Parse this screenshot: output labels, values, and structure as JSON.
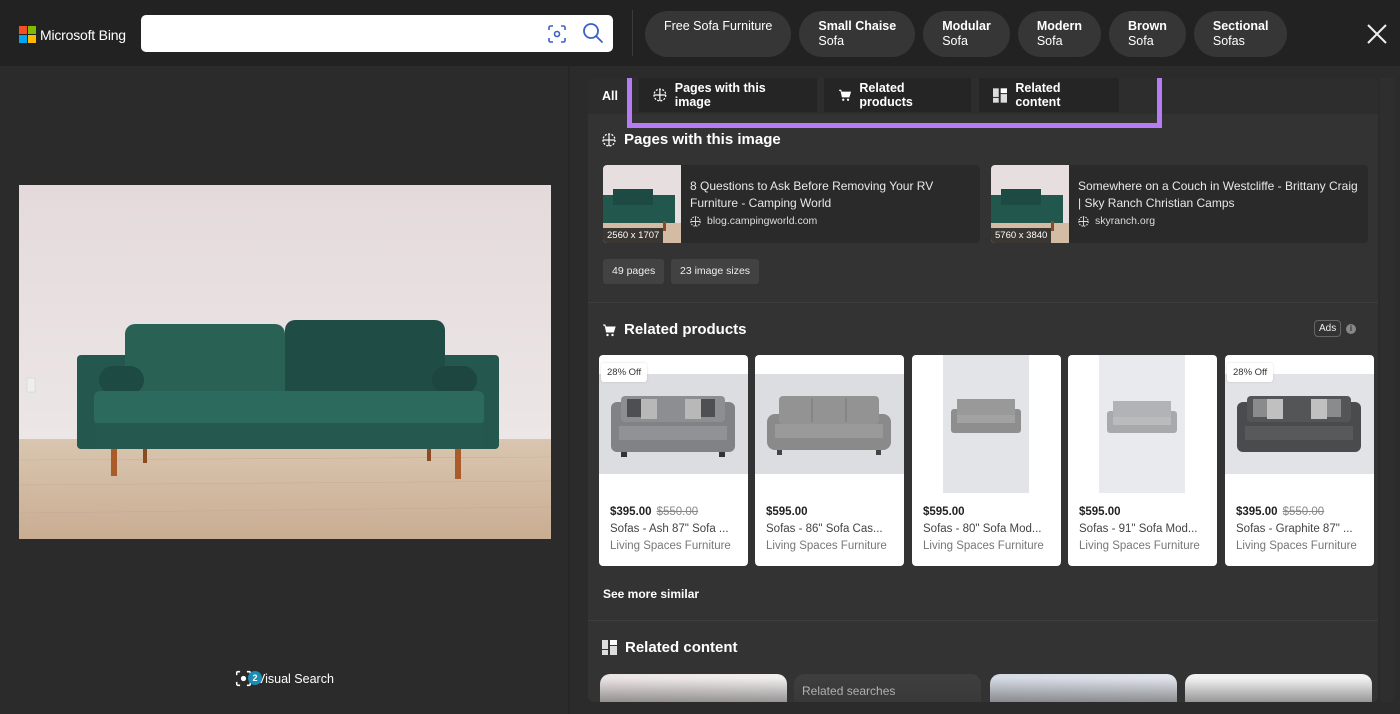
{
  "header": {
    "brand": "Microsoft Bing",
    "search": {
      "value": "",
      "placeholder": ""
    },
    "chips": [
      {
        "line1": "Free Sofa Furniture",
        "line2": ""
      },
      {
        "line1": "Small Chaise",
        "line2": "Sofa"
      },
      {
        "line1": "Modular",
        "line2": "Sofa"
      },
      {
        "line1": "Modern",
        "line2": "Sofa"
      },
      {
        "line1": "Brown",
        "line2": "Sofa"
      },
      {
        "line1": "Sectional",
        "line2": "Sofas"
      }
    ],
    "close_icon": "close-icon"
  },
  "left": {
    "visual_search_label": "Visual Search",
    "visual_search_badge": "2"
  },
  "tabs": {
    "all": "All",
    "items": [
      {
        "label": "Pages with this image",
        "icon": "globe-icon"
      },
      {
        "label": "Related products",
        "icon": "cart-icon"
      },
      {
        "label": "Related content",
        "icon": "grid-icon"
      }
    ],
    "highlight_color": "#b57cf6"
  },
  "pages_section": {
    "title": "Pages with this image",
    "cards": [
      {
        "title": "8 Questions to Ask Before Removing Your RV Furniture - Camping World",
        "domain": "blog.campingworld.com",
        "dims": "2560 x 1707"
      },
      {
        "title": "Somewhere on a Couch in Westcliffe - Brittany Craig | Sky Ranch Christian Camps",
        "domain": "skyranch.org",
        "dims": "5760 x 3840"
      }
    ],
    "pills": [
      "49 pages",
      "23 image sizes"
    ]
  },
  "products_section": {
    "title": "Related products",
    "ads_label": "Ads",
    "products": [
      {
        "badge": "28% Off",
        "price": "$395.00",
        "old_price": "$550.00",
        "name": "Sofas - Ash 87\" Sofa ...",
        "seller": "Living Spaces Furniture"
      },
      {
        "badge": "",
        "price": "$595.00",
        "old_price": "",
        "name": "Sofas - 86\" Sofa Cas...",
        "seller": "Living Spaces Furniture"
      },
      {
        "badge": "",
        "price": "$595.00",
        "old_price": "",
        "name": "Sofas - 80\" Sofa Mod...",
        "seller": "Living Spaces Furniture"
      },
      {
        "badge": "",
        "price": "$595.00",
        "old_price": "",
        "name": "Sofas - 91\" Sofa Mod...",
        "seller": "Living Spaces Furniture"
      },
      {
        "badge": "28% Off",
        "price": "$395.00",
        "old_price": "$550.00",
        "name": "Sofas - Graphite 87\" ...",
        "seller": "Living Spaces Furniture"
      }
    ],
    "see_more": "See more similar"
  },
  "related_content": {
    "title": "Related content",
    "cards": [
      "",
      "Related searches",
      "",
      ""
    ]
  }
}
